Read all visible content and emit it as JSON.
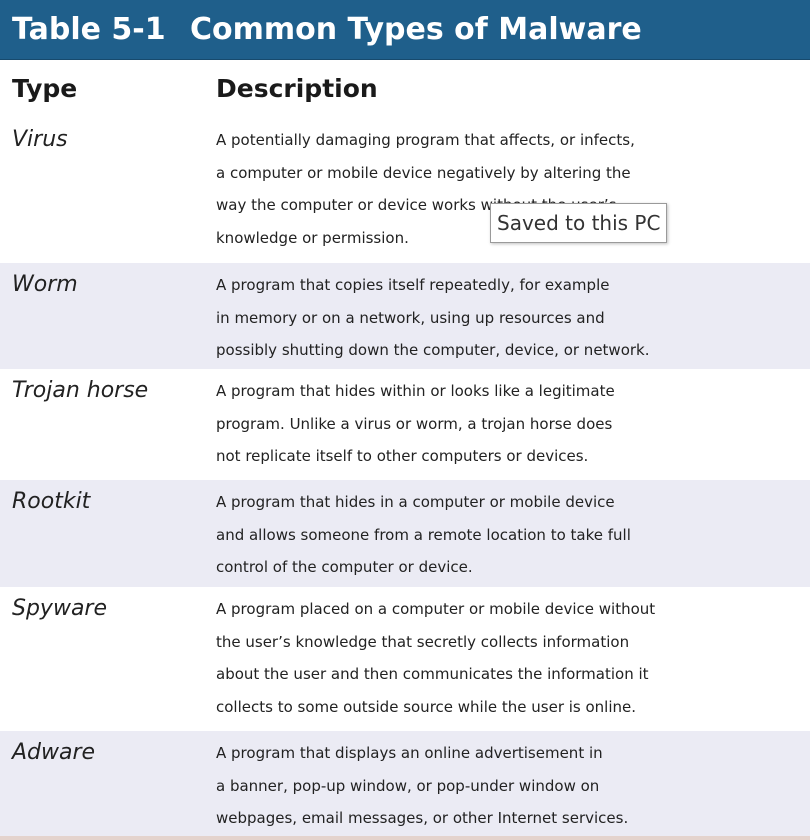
{
  "title": {
    "number": "Table 5-1",
    "name": "Common Types of Malware"
  },
  "headers": {
    "type": "Type",
    "description": "Description"
  },
  "rows": [
    {
      "type": "Virus",
      "lines": [
        "A potentially damaging program that affects, or infects,",
        "a computer or mobile device negatively by altering the",
        "way the computer or device works without the user’s",
        "knowledge or permission."
      ]
    },
    {
      "type": "Worm",
      "lines": [
        "A program that copies itself repeatedly, for example",
        "in memory or on a network, using up resources and",
        "possibly shutting down the computer, device, or network."
      ]
    },
    {
      "type": "Trojan horse",
      "lines": [
        "A program that hides within or looks like a legitimate",
        "program. Unlike a virus or worm, a trojan horse does",
        "not replicate itself to other computers or devices."
      ]
    },
    {
      "type": "Rootkit",
      "lines": [
        "A program that hides in a computer or mobile device",
        "and allows someone from a remote location to take full",
        "control of the computer or device."
      ]
    },
    {
      "type": "Spyware",
      "lines": [
        "A program placed on a computer or mobile device without",
        "the user’s knowledge that secretly collects information",
        "about the user and then communicates the information it",
        "collects to some outside source while the user is online."
      ]
    },
    {
      "type": "Adware",
      "lines": [
        "A program that displays an online advertisement in",
        "a banner, pop-up window, or pop-under window on",
        "webpages, email messages, or other Internet services."
      ]
    }
  ],
  "tooltip": {
    "text": "Saved to this PC"
  },
  "colors": {
    "title_bar": "#1f5f8b",
    "row_alt": "#ebebf4"
  }
}
